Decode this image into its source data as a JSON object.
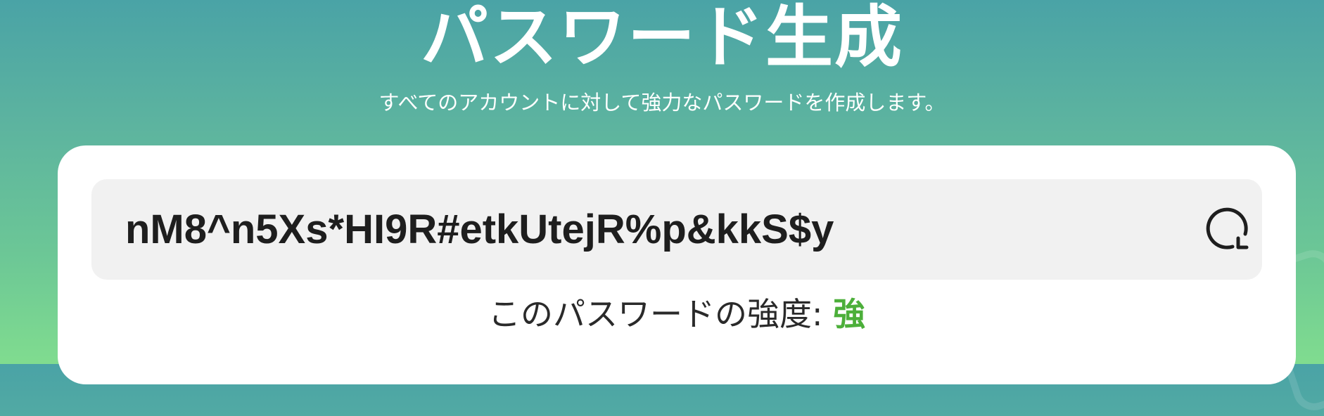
{
  "header": {
    "title": "パスワード生成",
    "subtitle": "すべてのアカウントに対して強力なパスワードを作成します。"
  },
  "generator": {
    "password": "nM8^n5Xs*HI9R#etkUtejR%p&kkS$y",
    "refresh_icon": "refresh-icon",
    "strength_label": "このパスワードの強度: ",
    "strength_value": "強",
    "strength_color": "#4caf3a"
  }
}
